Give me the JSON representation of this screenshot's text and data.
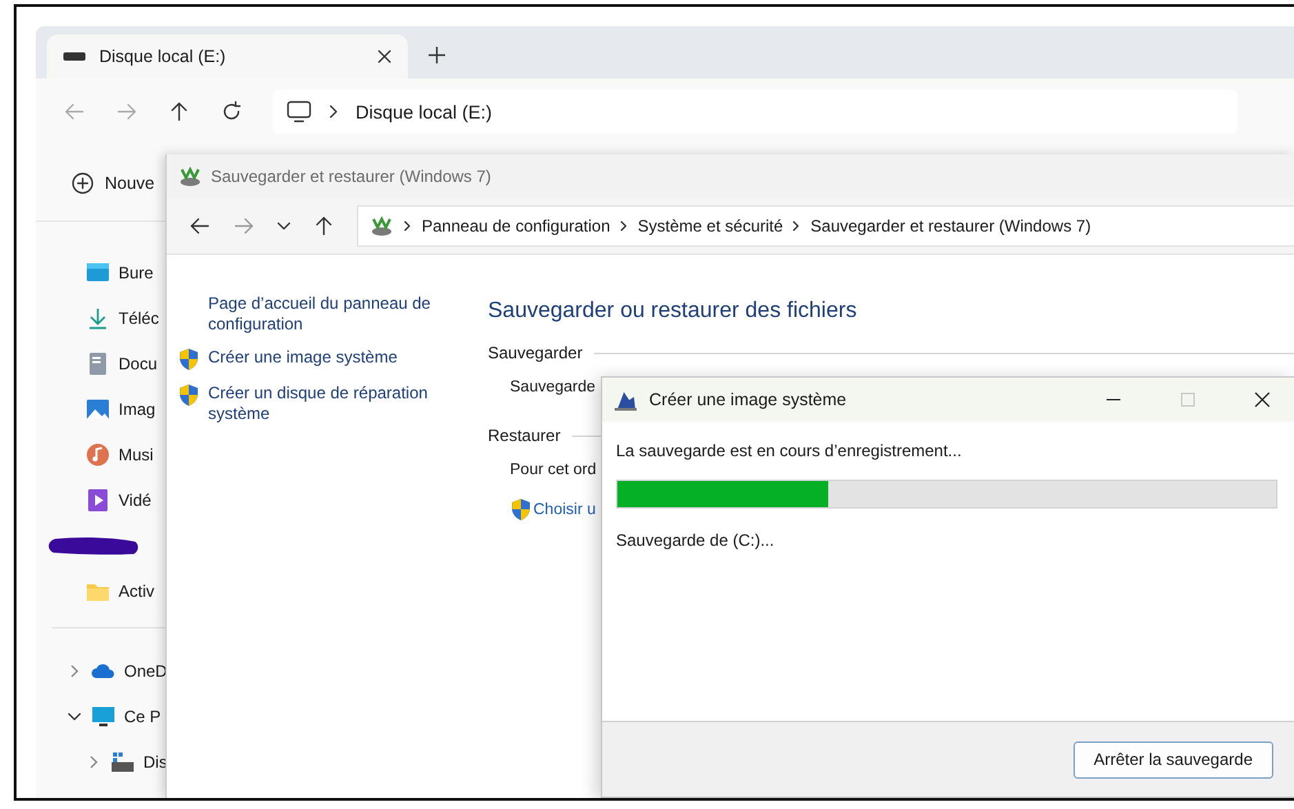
{
  "explorer": {
    "tabs": [
      {
        "label": "Disque local (E:)",
        "selected": true
      }
    ],
    "address": {
      "segments": [
        "Disque local (E:)"
      ]
    },
    "command": "Nouve",
    "sidebar": {
      "items": [
        {
          "label": "Bure",
          "kind": "desktop"
        },
        {
          "label": "Téléc",
          "kind": "download"
        },
        {
          "label": "Docu",
          "kind": "document"
        },
        {
          "label": "Imag",
          "kind": "image"
        },
        {
          "label": "Musi",
          "kind": "music"
        },
        {
          "label": "Vidé",
          "kind": "video"
        },
        {
          "kind": "redacted"
        },
        {
          "label": "Activ",
          "kind": "folder"
        }
      ],
      "tree": [
        {
          "label": "OneD",
          "kind": "cloud",
          "expanded": false
        },
        {
          "label": "Ce P",
          "kind": "pc",
          "expanded": true,
          "children": [
            {
              "label": "Dis",
              "kind": "drive",
              "expanded": false
            }
          ]
        }
      ]
    }
  },
  "control_panel": {
    "window": {
      "title": "Sauvegarder et restaurer (Windows 7)"
    },
    "breadcrumb": [
      "Panneau de configuration",
      "Système et sécurité",
      "Sauvegarder et restaurer (Windows 7)"
    ],
    "left_links": [
      {
        "label": "Page d’accueil du panneau de configuration",
        "kind": "link"
      },
      {
        "label": "Créer une image système",
        "kind": "shield-link"
      },
      {
        "label": "Créer un disque de réparation système",
        "kind": "shield-link"
      }
    ],
    "heading": "Sauvegarder ou restaurer des fichiers",
    "sections": [
      {
        "title": "Sauvegarder",
        "lines": [
          {
            "text": "Sauvegarde",
            "kind": "text"
          }
        ]
      },
      {
        "title": "Restaurer",
        "lines": [
          {
            "text": "Pour cet ord",
            "kind": "text"
          },
          {
            "text": "Choisir u",
            "kind": "shield-link"
          }
        ]
      }
    ]
  },
  "dialog": {
    "title": "Créer une image système",
    "title_buttons": [
      {
        "kind": "minimize",
        "disabled": false
      },
      {
        "kind": "maximize",
        "disabled": true
      },
      {
        "kind": "close",
        "disabled": false
      }
    ],
    "status": "La sauvegarde est en cours d’enregistrement...",
    "progress": {
      "level": 0.32
    },
    "detail": "Sauvegarde de (C:)...",
    "buttons": [
      "Arrêter la sauvegarde"
    ]
  }
}
